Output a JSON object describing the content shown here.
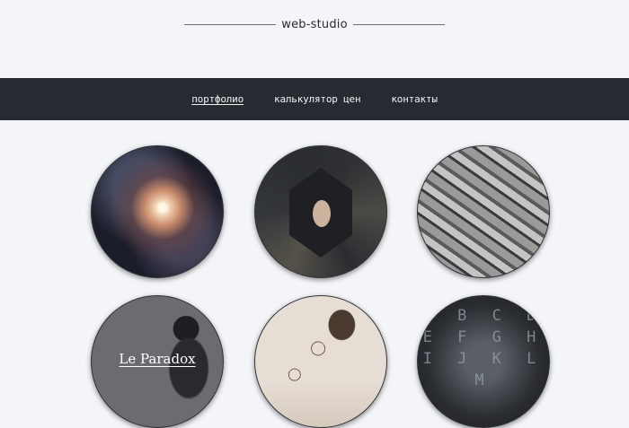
{
  "logo": {
    "text": "web-studio"
  },
  "nav": {
    "items": [
      {
        "label": "портфолио",
        "active": true
      },
      {
        "label": "калькулятор цен",
        "active": false
      },
      {
        "label": "контакты",
        "active": false
      }
    ]
  },
  "portfolio": {
    "items": [
      {
        "image": "spiral-galaxy"
      },
      {
        "image": "hexagon-collage"
      },
      {
        "image": "stone-pile"
      },
      {
        "image": "woman-portrait",
        "title": "Le Paradox"
      },
      {
        "image": "sketches-table"
      },
      {
        "image": "letters-wall",
        "letters": "A B C D E F G H I J K L M"
      }
    ]
  }
}
